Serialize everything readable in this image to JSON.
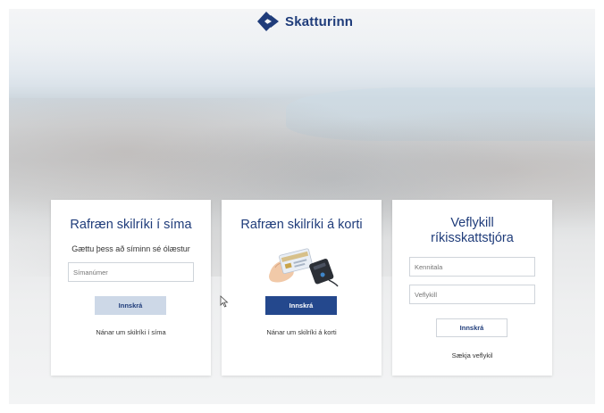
{
  "brand": {
    "name": "Skatturinn",
    "color": "#1f3c7a"
  },
  "cards": [
    {
      "title": "Rafræn skilríki í síma",
      "subtitle": "Gættu þess að síminn sé ólæstur",
      "phone_placeholder": "Símanúmer",
      "login_label": "Innskrá",
      "info_link": "Nánar um skilríki í síma"
    },
    {
      "title": "Rafræn skilríki á korti",
      "image_icon": "card-reader-illustration",
      "login_label": "Innskrá",
      "info_link": "Nánar um skilríki á korti"
    },
    {
      "title_line1": "Veflykill",
      "title_line2": "ríkisskattstjóra",
      "kennitala_placeholder": "Kennitala",
      "veflykill_placeholder": "Veflykill",
      "login_label": "Innskrá",
      "get_key_link": "Sækja veflykil"
    }
  ],
  "colors": {
    "primary": "#24488d",
    "disabled": "#cdd8e7",
    "title": "#1f3c7a"
  }
}
